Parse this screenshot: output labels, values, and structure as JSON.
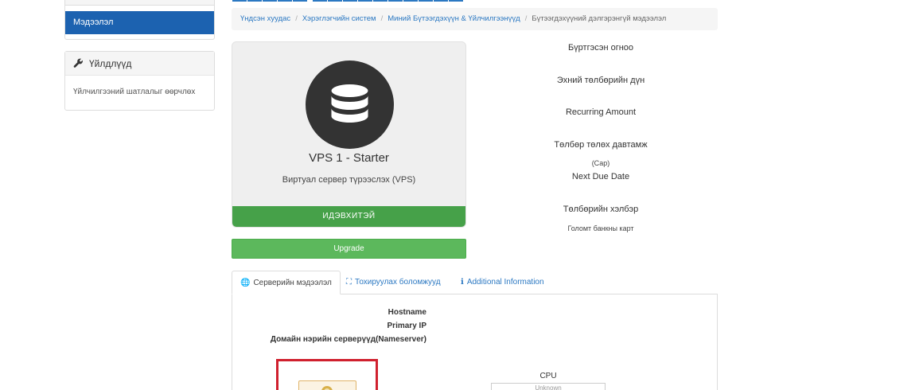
{
  "sidebar": {
    "info_item": "Мэдээлэл",
    "actions_title": "Үйлдлүүд",
    "actions_item": "Үйлчилгээний шатлалыг өөрчлөх"
  },
  "breadcrumb": {
    "items": [
      "Үндсэн хуудас",
      "Хэрэглэгчийн систем",
      "Миний Бүтээгдэхүүн & Үйлчилгээнүүд"
    ],
    "current": "Бүтээгдэхүүний дэлгэрэнгүй мэдээлэл"
  },
  "product": {
    "icon": "database-icon",
    "name": "VPS 1 - Starter",
    "group": "Виртуал сервер түрээслэх (VPS)",
    "status": "ИДЭВХИТЭЙ",
    "upgrade_label": "Upgrade"
  },
  "details": {
    "registration_date_label": "Бүртгэсэн огноо",
    "first_payment_label": "Эхний төлбөрийн дүн",
    "recurring_amount_label": "Recurring Amount",
    "billing_cycle_label": "Төлбөр төлөх давтамж",
    "billing_cycle_value": "(Сар)",
    "next_due_label": "Next Due Date",
    "payment_method_label": "Төлбөрийн хэлбэр",
    "payment_method_value": "Голомт банкны карт"
  },
  "tabs": [
    {
      "label": "Серверийн мэдээлэл",
      "icon": "globe-icon"
    },
    {
      "label": "Тохируулах боломжууд",
      "icon": "cubes-icon"
    },
    {
      "label": "Additional Information",
      "icon": "info-icon"
    }
  ],
  "server": {
    "hostname_label": "Hostname",
    "primary_ip_label": "Primary IP",
    "nameservers_label": "Домайн нэрийн серверүүд(Nameserver)",
    "cpu_label": "CPU",
    "cpu_value": "Unknown"
  },
  "colors": {
    "accent": "#1c62b0",
    "link": "#2b78c2",
    "status_green": "#46a149",
    "button_green": "#5cb85c",
    "highlight_red": "#d0202e"
  }
}
